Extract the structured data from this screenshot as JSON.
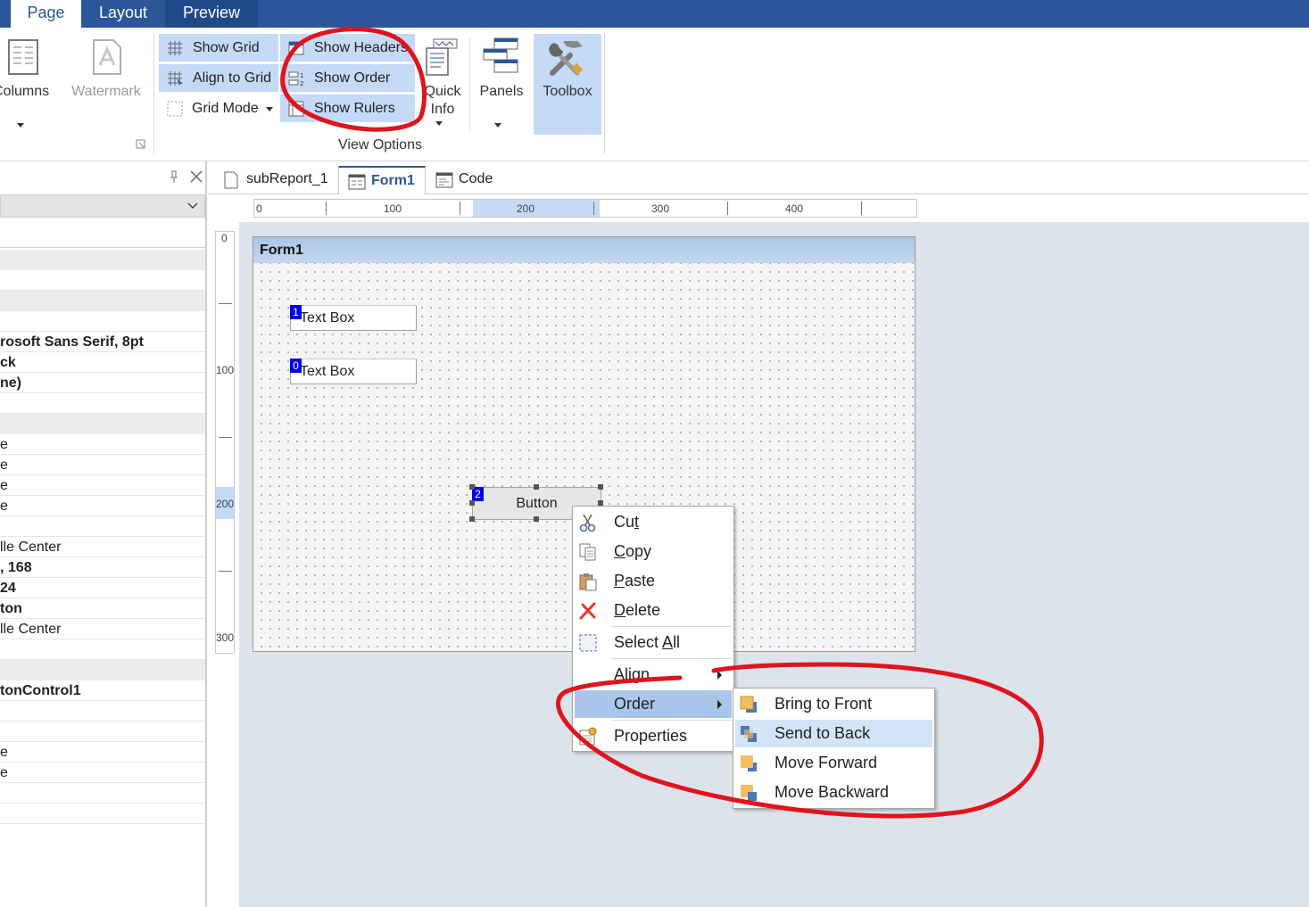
{
  "tabs": [
    "Page",
    "Layout",
    "Preview"
  ],
  "ribbon": {
    "columns_label": "Columns",
    "watermark_label": "Watermark",
    "show_grid": "Show Grid",
    "align_to_grid": "Align to Grid",
    "grid_mode": "Grid Mode",
    "show_headers": "Show Headers",
    "show_order": "Show Order",
    "show_rulers": "Show Rulers",
    "quick_info_line1": "Quick",
    "quick_info_line2": "Info",
    "panels_label": "Panels",
    "toolbox_label": "Toolbox",
    "group_view_options": "View Options"
  },
  "properties": {
    "values": [
      "rosoft Sans Serif, 8pt",
      "ck",
      "ne)",
      "e",
      "e",
      "e",
      "e",
      "lle Center",
      ", 168",
      "24",
      "ton",
      "lle Center",
      "tonControl1",
      "e",
      "e"
    ]
  },
  "doc_tabs": [
    "subReport_1",
    "Form1",
    "Code"
  ],
  "ruler": {
    "h": [
      "0",
      "100",
      "200",
      "300",
      "400"
    ],
    "v": [
      "0",
      "100",
      "200",
      "300"
    ]
  },
  "form": {
    "title": "Form1",
    "textbox1": {
      "text": "Text Box",
      "order": "1"
    },
    "textbox2": {
      "text": "Text Box",
      "order": "0"
    },
    "button": {
      "text": "Button",
      "order": "2"
    }
  },
  "context_menu": {
    "cut_pre": "Cu",
    "cut_u": "t",
    "copy_u": "C",
    "copy_post": "opy",
    "paste_u": "P",
    "paste_post": "aste",
    "delete_u": "D",
    "delete_post": "elete",
    "selectall_pre": "Select ",
    "selectall_u": "A",
    "selectall_post": "ll",
    "align": "Align",
    "order": "Order",
    "properties": "Properties"
  },
  "submenu": [
    "Bring to Front",
    "Send to Back",
    "Move Forward",
    "Move Backward"
  ],
  "colors": {
    "accent": "#2b579a",
    "annotation": "#e0141e",
    "order_badge": "#0000e6"
  }
}
